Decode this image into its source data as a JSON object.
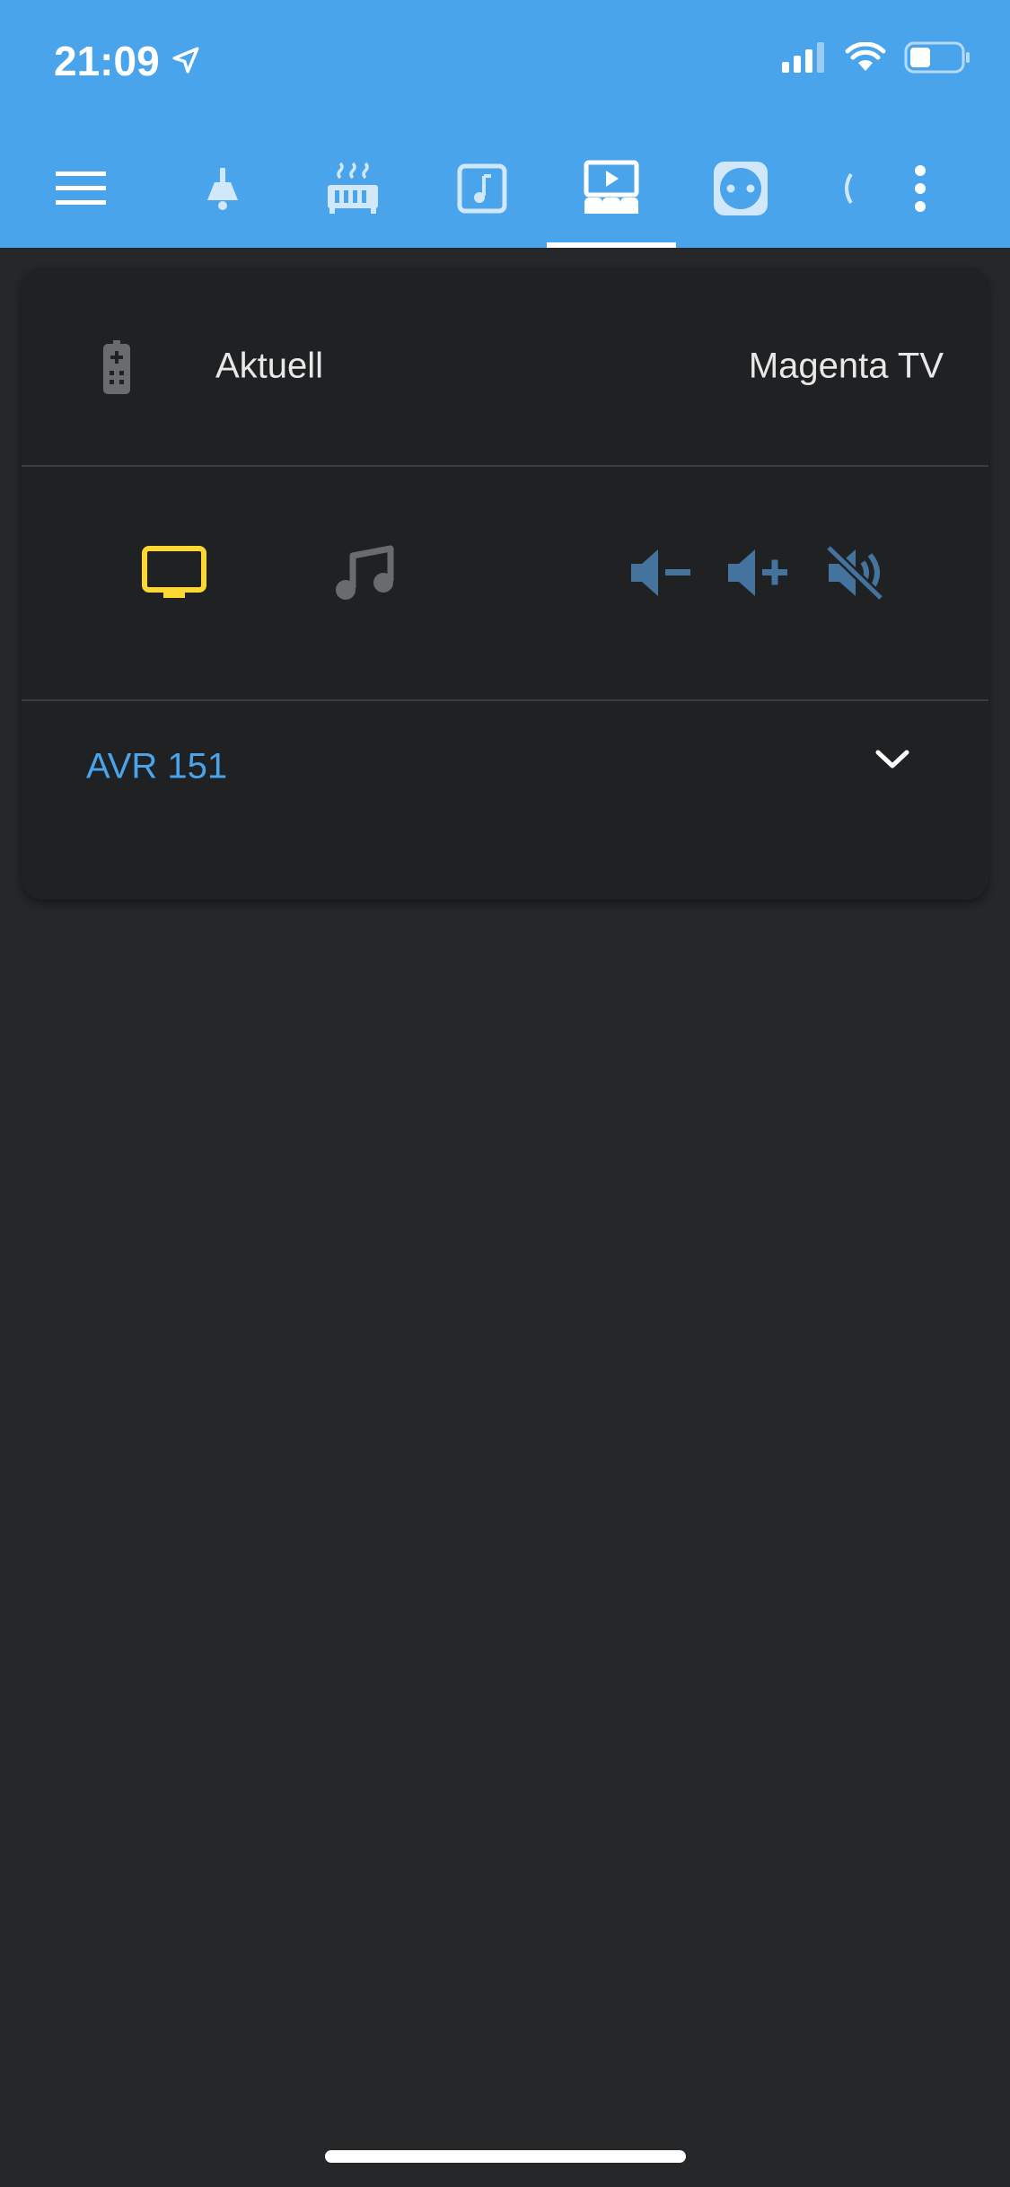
{
  "status_bar": {
    "time": "21:09"
  },
  "tabs": [
    {
      "name": "menu-icon"
    },
    {
      "name": "ceiling-lamp-icon"
    },
    {
      "name": "radiator-icon"
    },
    {
      "name": "music-box-icon"
    },
    {
      "name": "home-theater-icon",
      "active": true
    },
    {
      "name": "power-socket-icon"
    },
    {
      "name": "partial-tab-icon"
    },
    {
      "name": "more-vertical-icon"
    }
  ],
  "card": {
    "source_label": "Aktuell",
    "source_value": "Magenta TV",
    "receiver_label": "AVR 151"
  },
  "colors": {
    "header": "#4aa4eb",
    "background": "#262729",
    "card": "#202123",
    "active_tv": "#fdd835",
    "volume_controls": "#44739e",
    "link": "#4aa4eb"
  }
}
